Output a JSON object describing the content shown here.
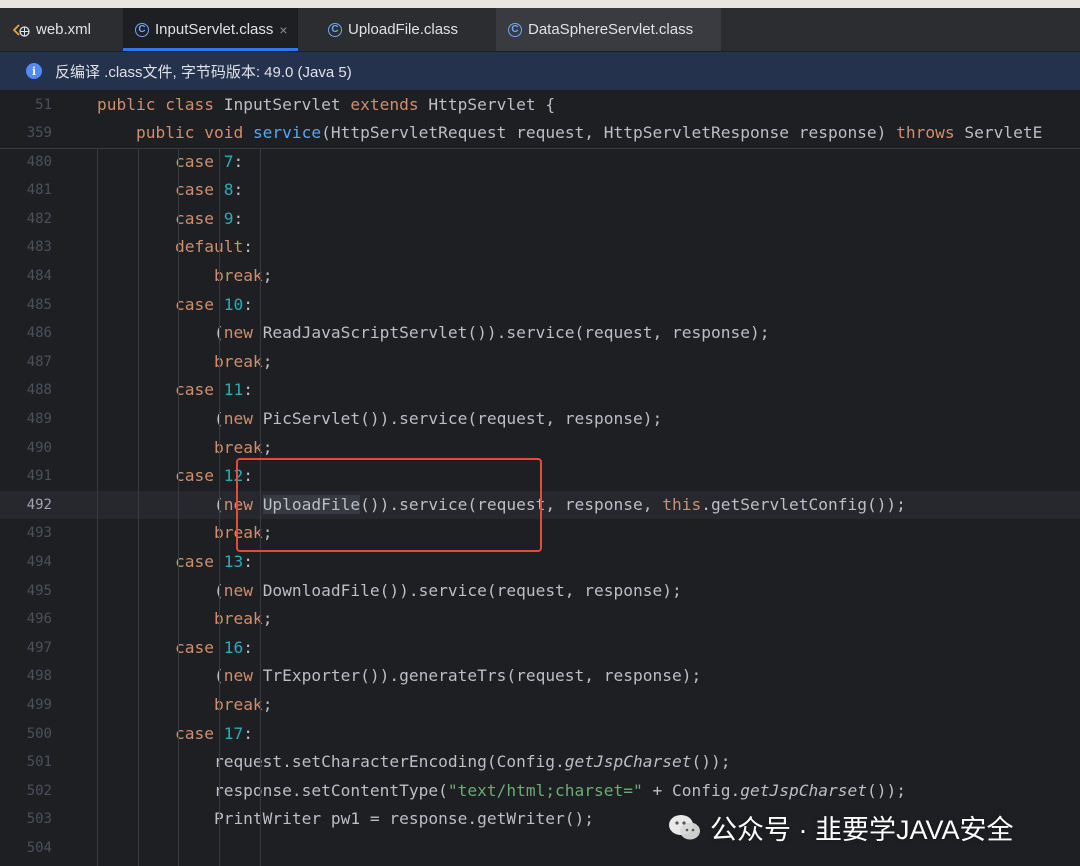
{
  "tabs": [
    {
      "label": "web.xml",
      "icon": "xml-file-icon",
      "active": false
    },
    {
      "label": "InputServlet.class",
      "icon": "class-file-icon",
      "active": true
    },
    {
      "label": "UploadFile.class",
      "icon": "class-file-icon",
      "active": false
    },
    {
      "label": "DataSphereServlet.class",
      "icon": "class-file-icon",
      "active": false
    }
  ],
  "class_icon_letter": "C",
  "banner": {
    "icon": "info-icon",
    "icon_glyph": "i",
    "text": "反编译 .class文件, 字节码版本: 49.0 (Java 5)"
  },
  "sticky_lines": [
    {
      "num": "51",
      "segments": [
        {
          "t": "public class ",
          "c": "kw"
        },
        {
          "t": "InputServlet ",
          "c": ""
        },
        {
          "t": "extends ",
          "c": "kw"
        },
        {
          "t": "HttpServlet {",
          "c": ""
        }
      ]
    },
    {
      "num": "359",
      "segments": [
        {
          "t": "    ",
          "c": ""
        },
        {
          "t": "public void ",
          "c": "kw"
        },
        {
          "t": "service",
          "c": "fn"
        },
        {
          "t": "(HttpServletRequest request, HttpServletResponse response) ",
          "c": ""
        },
        {
          "t": "throws ",
          "c": "kw"
        },
        {
          "t": "ServletE",
          "c": ""
        }
      ]
    }
  ],
  "lines": [
    {
      "num": "480",
      "segments": [
        {
          "t": "        ",
          "c": ""
        },
        {
          "t": "case ",
          "c": "kw"
        },
        {
          "t": "7",
          "c": "num"
        },
        {
          "t": ":",
          "c": ""
        }
      ]
    },
    {
      "num": "481",
      "segments": [
        {
          "t": "        ",
          "c": ""
        },
        {
          "t": "case ",
          "c": "kw"
        },
        {
          "t": "8",
          "c": "num"
        },
        {
          "t": ":",
          "c": ""
        }
      ]
    },
    {
      "num": "482",
      "segments": [
        {
          "t": "        ",
          "c": ""
        },
        {
          "t": "case ",
          "c": "kw"
        },
        {
          "t": "9",
          "c": "num"
        },
        {
          "t": ":",
          "c": ""
        }
      ]
    },
    {
      "num": "483",
      "segments": [
        {
          "t": "        ",
          "c": ""
        },
        {
          "t": "default",
          "c": "kw"
        },
        {
          "t": ":",
          "c": ""
        }
      ]
    },
    {
      "num": "484",
      "segments": [
        {
          "t": "            ",
          "c": ""
        },
        {
          "t": "break",
          "c": "kw"
        },
        {
          "t": ";",
          "c": ""
        }
      ]
    },
    {
      "num": "485",
      "segments": [
        {
          "t": "        ",
          "c": ""
        },
        {
          "t": "case ",
          "c": "kw"
        },
        {
          "t": "10",
          "c": "num"
        },
        {
          "t": ":",
          "c": ""
        }
      ]
    },
    {
      "num": "486",
      "segments": [
        {
          "t": "            (",
          "c": ""
        },
        {
          "t": "new ",
          "c": "kw"
        },
        {
          "t": "ReadJavaScriptServlet()).service(request, response);",
          "c": ""
        }
      ]
    },
    {
      "num": "487",
      "segments": [
        {
          "t": "            ",
          "c": ""
        },
        {
          "t": "break",
          "c": "kw"
        },
        {
          "t": ";",
          "c": ""
        }
      ]
    },
    {
      "num": "488",
      "segments": [
        {
          "t": "        ",
          "c": ""
        },
        {
          "t": "case ",
          "c": "kw"
        },
        {
          "t": "11",
          "c": "num"
        },
        {
          "t": ":",
          "c": ""
        }
      ]
    },
    {
      "num": "489",
      "segments": [
        {
          "t": "            (",
          "c": ""
        },
        {
          "t": "new ",
          "c": "kw"
        },
        {
          "t": "PicServlet()).service(request, response);",
          "c": ""
        }
      ]
    },
    {
      "num": "490",
      "segments": [
        {
          "t": "            ",
          "c": ""
        },
        {
          "t": "break",
          "c": "kw"
        },
        {
          "t": ";",
          "c": ""
        }
      ]
    },
    {
      "num": "491",
      "segments": [
        {
          "t": "        ",
          "c": ""
        },
        {
          "t": "case ",
          "c": "kw"
        },
        {
          "t": "12",
          "c": "num"
        },
        {
          "t": ":",
          "c": ""
        }
      ]
    },
    {
      "num": "492",
      "current": true,
      "segments": [
        {
          "t": "            (",
          "c": ""
        },
        {
          "t": "new ",
          "c": "kw"
        },
        {
          "t": "UploadFile",
          "c": "hlref"
        },
        {
          "t": "()).service(request, response, ",
          "c": ""
        },
        {
          "t": "this",
          "c": "kw"
        },
        {
          "t": ".getServletConfig());",
          "c": ""
        }
      ]
    },
    {
      "num": "493",
      "segments": [
        {
          "t": "            ",
          "c": ""
        },
        {
          "t": "break",
          "c": "kw"
        },
        {
          "t": ";",
          "c": ""
        }
      ]
    },
    {
      "num": "494",
      "segments": [
        {
          "t": "        ",
          "c": ""
        },
        {
          "t": "case ",
          "c": "kw"
        },
        {
          "t": "13",
          "c": "num"
        },
        {
          "t": ":",
          "c": ""
        }
      ]
    },
    {
      "num": "495",
      "segments": [
        {
          "t": "            (",
          "c": ""
        },
        {
          "t": "new ",
          "c": "kw"
        },
        {
          "t": "DownloadFile()).service(request, response);",
          "c": ""
        }
      ]
    },
    {
      "num": "496",
      "segments": [
        {
          "t": "            ",
          "c": ""
        },
        {
          "t": "break",
          "c": "kw"
        },
        {
          "t": ";",
          "c": ""
        }
      ]
    },
    {
      "num": "497",
      "segments": [
        {
          "t": "        ",
          "c": ""
        },
        {
          "t": "case ",
          "c": "kw"
        },
        {
          "t": "16",
          "c": "num"
        },
        {
          "t": ":",
          "c": ""
        }
      ]
    },
    {
      "num": "498",
      "segments": [
        {
          "t": "            (",
          "c": ""
        },
        {
          "t": "new ",
          "c": "kw"
        },
        {
          "t": "TrExporter()).generateTrs(request, response);",
          "c": ""
        }
      ]
    },
    {
      "num": "499",
      "segments": [
        {
          "t": "            ",
          "c": ""
        },
        {
          "t": "break",
          "c": "kw"
        },
        {
          "t": ";",
          "c": ""
        }
      ]
    },
    {
      "num": "500",
      "segments": [
        {
          "t": "        ",
          "c": ""
        },
        {
          "t": "case ",
          "c": "kw"
        },
        {
          "t": "17",
          "c": "num"
        },
        {
          "t": ":",
          "c": ""
        }
      ]
    },
    {
      "num": "501",
      "segments": [
        {
          "t": "            request.setCharacterEncoding(Config.",
          "c": ""
        },
        {
          "t": "getJspCharset",
          "c": "it"
        },
        {
          "t": "());",
          "c": ""
        }
      ]
    },
    {
      "num": "502",
      "segments": [
        {
          "t": "            response.setContentType(",
          "c": ""
        },
        {
          "t": "\"text/html;charset=\"",
          "c": "str"
        },
        {
          "t": " + Config.",
          "c": ""
        },
        {
          "t": "getJspCharset",
          "c": "it"
        },
        {
          "t": "());",
          "c": ""
        }
      ]
    },
    {
      "num": "503",
      "segments": [
        {
          "t": "            PrintWriter pw1 = response.getWriter();",
          "c": ""
        }
      ]
    },
    {
      "num": "504",
      "segments": []
    }
  ],
  "watermark": {
    "icon": "wechat-icon",
    "text": "公众号 · 韭要学JAVA安全"
  },
  "colors": {
    "keyword": "#cf8e6d",
    "number": "#2aacb8",
    "function": "#56a8f5",
    "string": "#6aab73",
    "highlight_box": "#e84a3a",
    "tab_accent": "#3574f0",
    "banner_bg": "#25324d"
  }
}
